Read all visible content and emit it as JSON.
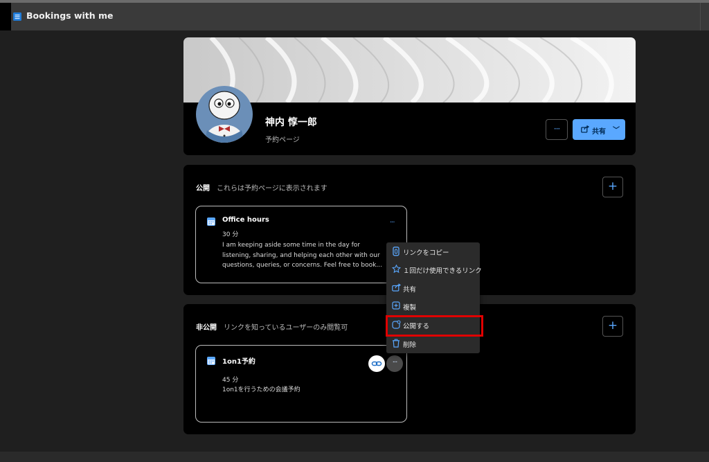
{
  "app": {
    "title": "Bookings with me",
    "icon": "bookings-app-icon"
  },
  "profile": {
    "name": "神内 惇一郎",
    "subtitle": "予約ページ",
    "more_label": "···",
    "share_label": "共有",
    "share_chevron": "﹀",
    "share_icon": "share-icon"
  },
  "public_section": {
    "title": "公開",
    "description": "これらは予約ページに表示されます",
    "add_label": "+",
    "services": [
      {
        "title": "Office hours",
        "duration": "30 分",
        "description": "I am keeping aside some time in the day for listening, sharing, and helping each other with our questions, queries, or concerns. Feel free to book...",
        "more_label": "···"
      }
    ]
  },
  "private_section": {
    "title": "非公開",
    "description": "リンクを知っているユーザーのみ閲覧可",
    "add_label": "+",
    "services": [
      {
        "title": "1on1予約",
        "duration": "45 分",
        "description": "1on1を行うための会議予約",
        "more_label": "···"
      }
    ]
  },
  "context_menu": {
    "items": [
      {
        "label": "リンクをコピー",
        "icon": "copy-link-icon"
      },
      {
        "label": "１回だけ使用できるリンク",
        "icon": "one-time-link-icon"
      },
      {
        "label": "共有",
        "icon": "share-icon"
      },
      {
        "label": "複製",
        "icon": "duplicate-icon"
      },
      {
        "label": "公開する",
        "icon": "publish-icon",
        "highlighted": true
      },
      {
        "label": "削除",
        "icon": "delete-icon"
      }
    ]
  },
  "colors": {
    "accent": "#5aa8ff",
    "highlight": "#e00000",
    "card_bg": "#000000",
    "page_bg": "#1f1f1f"
  }
}
